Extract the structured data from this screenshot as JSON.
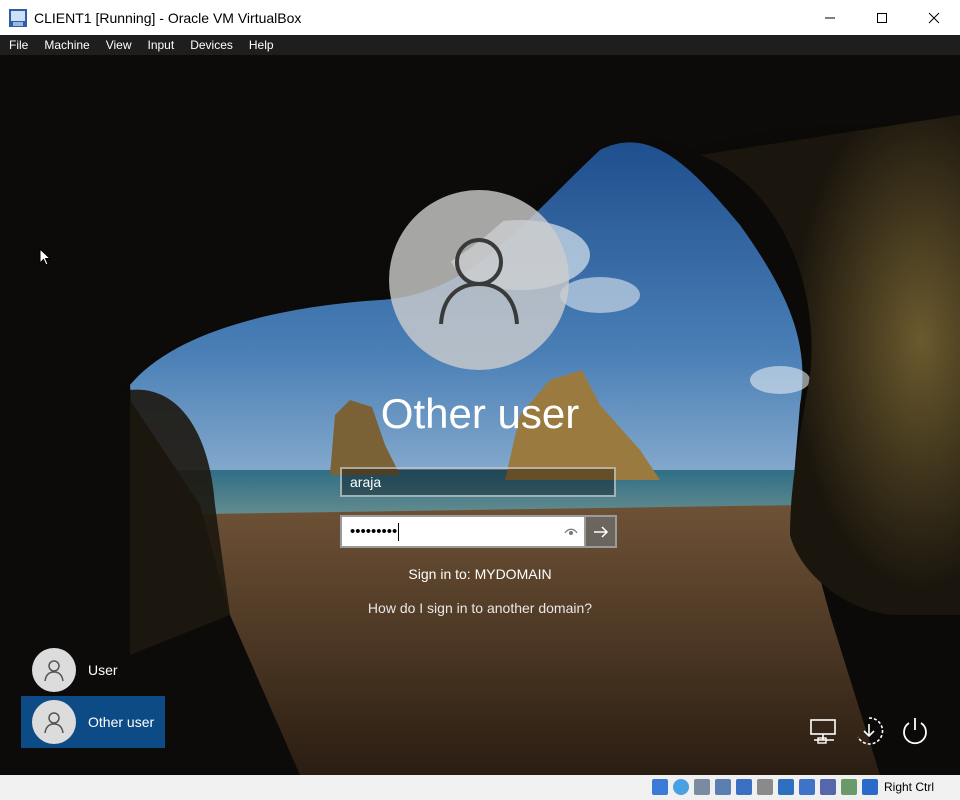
{
  "window": {
    "title": "CLIENT1 [Running] - Oracle VM VirtualBox",
    "menu": [
      "File",
      "Machine",
      "View",
      "Input",
      "Devices",
      "Help"
    ]
  },
  "login": {
    "display_name": "Other user",
    "username_value": "araja",
    "password_masked": "•••••••••",
    "sign_in_to": "Sign in to: MYDOMAIN",
    "other_domain_link": "How do I sign in to another domain?"
  },
  "user_tiles": [
    {
      "label": "User",
      "selected": false
    },
    {
      "label": "Other user",
      "selected": true
    }
  ],
  "bottom_icons": [
    "network-icon",
    "ease-of-access-icon",
    "power-icon"
  ],
  "statusbar": {
    "host_key": "Right Ctrl",
    "icons": [
      "hard-disk-icon",
      "optical-drive-icon",
      "audio-icon",
      "network-adapter-icon",
      "usb-icon",
      "shared-folders-icon",
      "display-icon",
      "video-capture-icon",
      "virtualization-icon",
      "cpu-icon",
      "mouse-integration-icon"
    ]
  },
  "colors": {
    "selected_tile": "#0d4b86",
    "menubar": "#1e1e1e",
    "statusbar": "#f0f0f0"
  }
}
